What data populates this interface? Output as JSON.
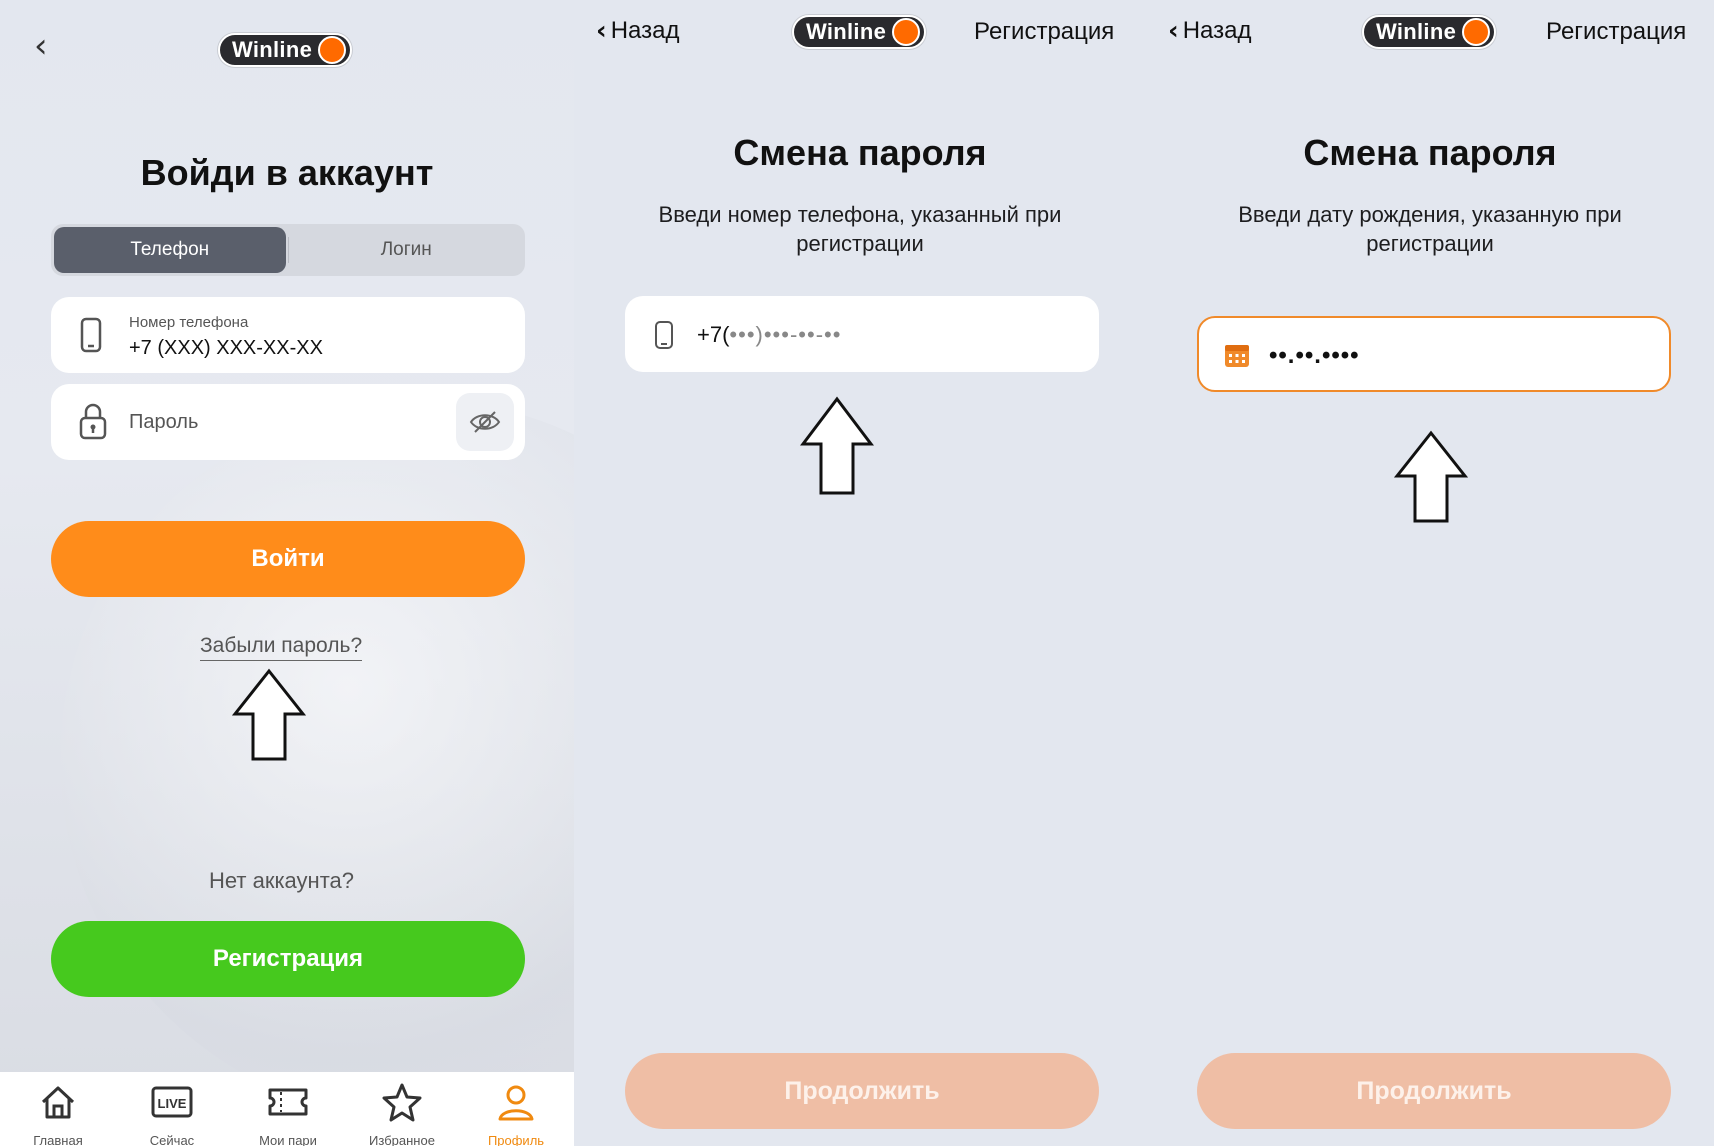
{
  "brand": {
    "logo_text": "Winline",
    "accent": "#ff8c1a",
    "green": "#46c91e"
  },
  "screen1": {
    "title": "Войди в аккаунт",
    "segments": [
      {
        "label": "Телефон",
        "active": true
      },
      {
        "label": "Логин",
        "active": false
      }
    ],
    "phone_field": {
      "label": "Номер телефона",
      "value": "+7 (XXX) XXX-XX-XX"
    },
    "password_field": {
      "placeholder": "Пароль"
    },
    "login_button": "Войти",
    "forgot_link": "Забыли пароль?",
    "no_account": "Нет аккаунта?",
    "register_button": "Регистрация",
    "tabbar": [
      {
        "label": "Главная",
        "icon": "home-icon"
      },
      {
        "label": "Сейчас",
        "icon": "live-icon"
      },
      {
        "label": "Мои пари",
        "icon": "ticket-icon"
      },
      {
        "label": "Избранное",
        "icon": "star-icon"
      },
      {
        "label": "Профиль",
        "icon": "user-icon",
        "active": true
      }
    ]
  },
  "screen2": {
    "back": "Назад",
    "register": "Регистрация",
    "title": "Смена пароля",
    "subtitle_line1": "Введи номер телефона, указанный при",
    "subtitle_line2": "регистрации",
    "phone_prefix": "+7(",
    "phone_mask": "•••)•••-••-••",
    "continue_button": "Продолжить"
  },
  "screen3": {
    "back": "Назад",
    "register": "Регистрация",
    "title": "Смена пароля",
    "subtitle_line1": "Введи дату рождения, указанную при",
    "subtitle_line2": "регистрации",
    "date_mask": "••.••.••••",
    "continue_button": "Продолжить"
  }
}
